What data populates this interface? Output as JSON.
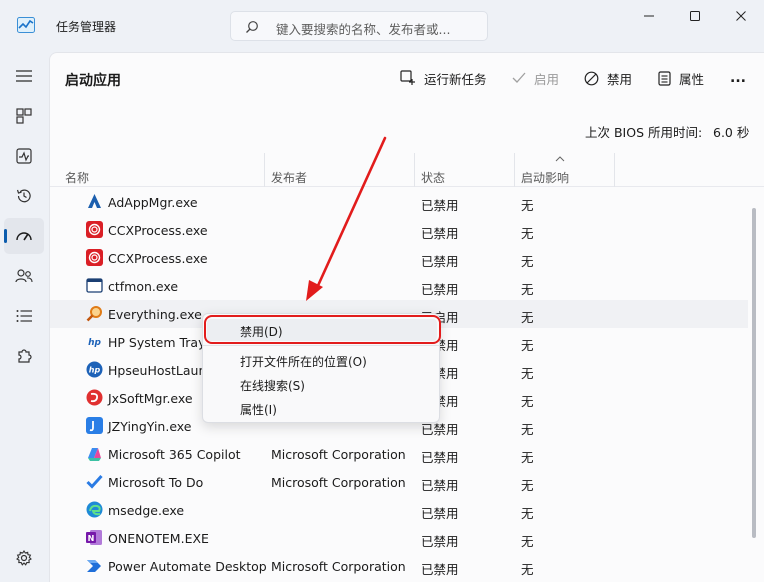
{
  "window": {
    "title": "任务管理器",
    "search_placeholder": "键入要搜索的名称、发布者或..."
  },
  "nav": {
    "items": [
      "hamburger",
      "processes",
      "performance",
      "app-history",
      "startup-apps",
      "users",
      "details",
      "services"
    ],
    "active": "startup-apps",
    "bottom": "settings"
  },
  "header": {
    "title": "启动应用",
    "run_new_task": "运行新任务",
    "enable": "启用",
    "disable": "禁用",
    "properties": "属性",
    "more": "..."
  },
  "bios": {
    "label": "上次 BIOS 所用时间:",
    "value": "6.0 秒"
  },
  "table": {
    "columns": [
      "名称",
      "发布者",
      "状态",
      "启动影响"
    ],
    "rows": [
      {
        "name": "AdAppMgr.exe",
        "publisher": "",
        "status": "已禁用",
        "impact": "无",
        "icon": "adobe-icon"
      },
      {
        "name": "CCXProcess.exe",
        "publisher": "",
        "status": "已禁用",
        "impact": "无",
        "icon": "creative-cloud-icon"
      },
      {
        "name": "CCXProcess.exe",
        "publisher": "",
        "status": "已禁用",
        "impact": "无",
        "icon": "creative-cloud-icon"
      },
      {
        "name": "ctfmon.exe",
        "publisher": "",
        "status": "已禁用",
        "impact": "无",
        "icon": "app-window-icon"
      },
      {
        "name": "Everything.exe",
        "publisher": "",
        "status": "已启用",
        "impact": "无",
        "icon": "everything-magnifier-icon"
      },
      {
        "name": "HP System Tray",
        "publisher": "",
        "status": "已禁用",
        "impact": "无",
        "icon": "hp-icon"
      },
      {
        "name": "HpseuHostLaunc",
        "publisher": "",
        "status": "已禁用",
        "impact": "无",
        "icon": "hp-icon"
      },
      {
        "name": "JxSoftMgr.exe",
        "publisher": "",
        "status": "已禁用",
        "impact": "无",
        "icon": "jx-softmgr-icon"
      },
      {
        "name": "JZYingYin.exe",
        "publisher": "",
        "status": "已禁用",
        "impact": "无",
        "icon": "jz-player-icon"
      },
      {
        "name": "Microsoft 365 Copilot",
        "publisher": "Microsoft Corporation",
        "status": "已禁用",
        "impact": "无",
        "icon": "m365-copilot-icon"
      },
      {
        "name": "Microsoft To Do",
        "publisher": "Microsoft Corporation",
        "status": "已禁用",
        "impact": "无",
        "icon": "todo-check-icon"
      },
      {
        "name": "msedge.exe",
        "publisher": "",
        "status": "已禁用",
        "impact": "无",
        "icon": "edge-icon"
      },
      {
        "name": "ONENOTEM.EXE",
        "publisher": "",
        "status": "已禁用",
        "impact": "无",
        "icon": "onenote-icon"
      },
      {
        "name": "Power Automate Desktop",
        "publisher": "Microsoft Corporation",
        "status": "已禁用",
        "impact": "无",
        "icon": "power-automate-icon"
      }
    ]
  },
  "context_menu": {
    "items": [
      "禁用(D)",
      "打开文件所在的位置(O)",
      "在线搜索(S)",
      "属性(I)"
    ]
  },
  "colors": {
    "accent": "#0b5cad",
    "annotation_red": "#e21c1c"
  }
}
